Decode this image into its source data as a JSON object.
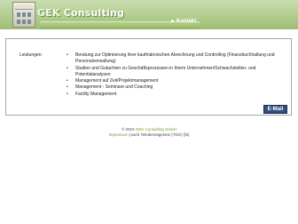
{
  "header": {
    "brand_part1": "GEK",
    "brand_part2": " Consulting",
    "nav_kontakt": "Kontakt",
    "accent": "#9fbf73"
  },
  "content": {
    "label": "Leistungen:",
    "items": [
      "Beratung zur Optimierung ihrer kaufmännischen Abrechnung und Controlling (Finanzbuchhaltung und Personalverwaltung)",
      "Studien und Gutachten zu Geschäftsprozessen in Ihrem Unternehmen/Schwachstellen- und Potentialanalysen",
      "Management auf Zeit/Projektmanagement",
      "Management - Seminare und Coaching",
      "Facility Management"
    ],
    "email_label": "E-Mail"
  },
  "footer": {
    "copyright": "© 2010 ",
    "company": "GEK Consulting GmbH",
    "impressum": "Impressum",
    "impressum_note": " (nach Teledienstgesetz (TDG) §6)"
  },
  "icons": {
    "logo": "building-logo-icon",
    "kontakt_arrow": "arrow-right-icon"
  }
}
